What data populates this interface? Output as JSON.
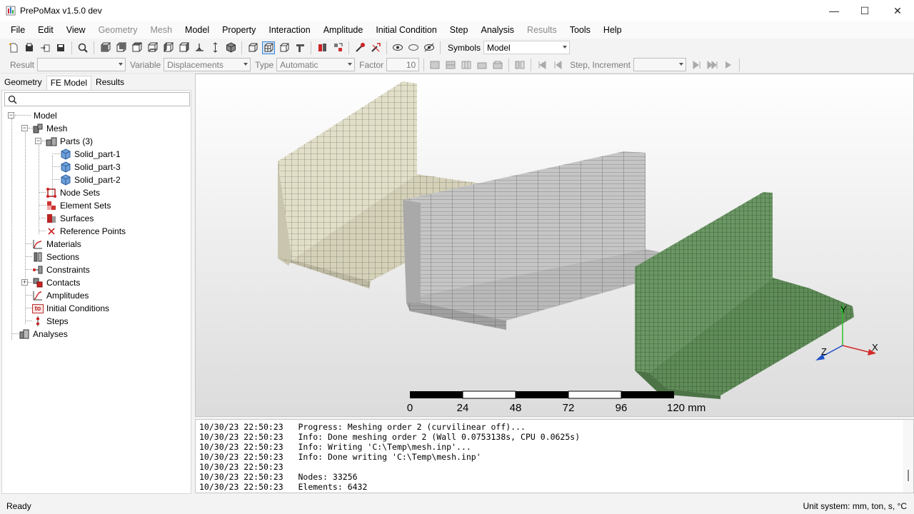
{
  "window": {
    "title": "PrePoMax v1.5.0 dev",
    "minimize_glyph": "—",
    "maximize_glyph": "☐",
    "close_glyph": "✕"
  },
  "menu": [
    {
      "label": "File",
      "enabled": true
    },
    {
      "label": "Edit",
      "enabled": true
    },
    {
      "label": "View",
      "enabled": true
    },
    {
      "label": "Geometry",
      "enabled": false
    },
    {
      "label": "Mesh",
      "enabled": false
    },
    {
      "label": "Model",
      "enabled": true
    },
    {
      "label": "Property",
      "enabled": true
    },
    {
      "label": "Interaction",
      "enabled": true
    },
    {
      "label": "Amplitude",
      "enabled": true
    },
    {
      "label": "Initial Condition",
      "enabled": true
    },
    {
      "label": "Step",
      "enabled": true
    },
    {
      "label": "Analysis",
      "enabled": true
    },
    {
      "label": "Results",
      "enabled": false
    },
    {
      "label": "Tools",
      "enabled": true
    },
    {
      "label": "Help",
      "enabled": true
    }
  ],
  "toolbar": {
    "symbols_label": "Symbols",
    "symbols_value": "Model"
  },
  "results_toolbar": {
    "result_label": "Result",
    "result_value": "",
    "variable_label": "Variable",
    "variable_value": "Displacements",
    "type_label": "Type",
    "type_value": "Automatic",
    "factor_label": "Factor",
    "factor_value": "10",
    "step_label": "Step, Increment",
    "step_value": ""
  },
  "tabs": [
    {
      "label": "Geometry",
      "active": false
    },
    {
      "label": "FE Model",
      "active": true
    },
    {
      "label": "Results",
      "active": false
    }
  ],
  "search": {
    "placeholder": ""
  },
  "tree": {
    "model": "Model",
    "mesh": "Mesh",
    "parts": "Parts (3)",
    "part1": "Solid_part-1",
    "part3": "Solid_part-3",
    "part2": "Solid_part-2",
    "node_sets": "Node Sets",
    "element_sets": "Element Sets",
    "surfaces": "Surfaces",
    "reference_points": "Reference Points",
    "materials": "Materials",
    "sections": "Sections",
    "constraints": "Constraints",
    "contacts": "Contacts",
    "amplitudes": "Amplitudes",
    "initial_conditions": "Initial Conditions",
    "initial_conditions_icon_text": "to",
    "steps": "Steps",
    "analyses": "Analyses"
  },
  "viewport": {
    "scale_labels": [
      "0",
      "24",
      "48",
      "72",
      "96",
      "120 mm"
    ],
    "axis_labels": {
      "x": "X",
      "y": "Y",
      "z": "Z"
    },
    "colors": {
      "part1": "#d7d4bd",
      "part3": "#c8c8c8",
      "part2": "#6e9a67",
      "x_axis": "#d42a2a",
      "y_axis": "#2fbf2f",
      "z_axis": "#2050c8"
    }
  },
  "log": [
    "10/30/23 22:50:23   Progress: Meshing order 2 (curvilinear off)...",
    "10/30/23 22:50:23   Info: Done meshing order 2 (Wall 0.0753138s, CPU 0.0625s)",
    "10/30/23 22:50:23   Info: Writing 'C:\\Temp\\mesh.inp'...",
    "10/30/23 22:50:23   Info: Done writing 'C:\\Temp\\mesh.inp'",
    "10/30/23 22:50:23",
    "10/30/23 22:50:23   Nodes: 33256",
    "10/30/23 22:50:23   Elements: 6432"
  ],
  "status": {
    "left": "Ready",
    "right": "Unit system: mm, ton, s, °C"
  }
}
